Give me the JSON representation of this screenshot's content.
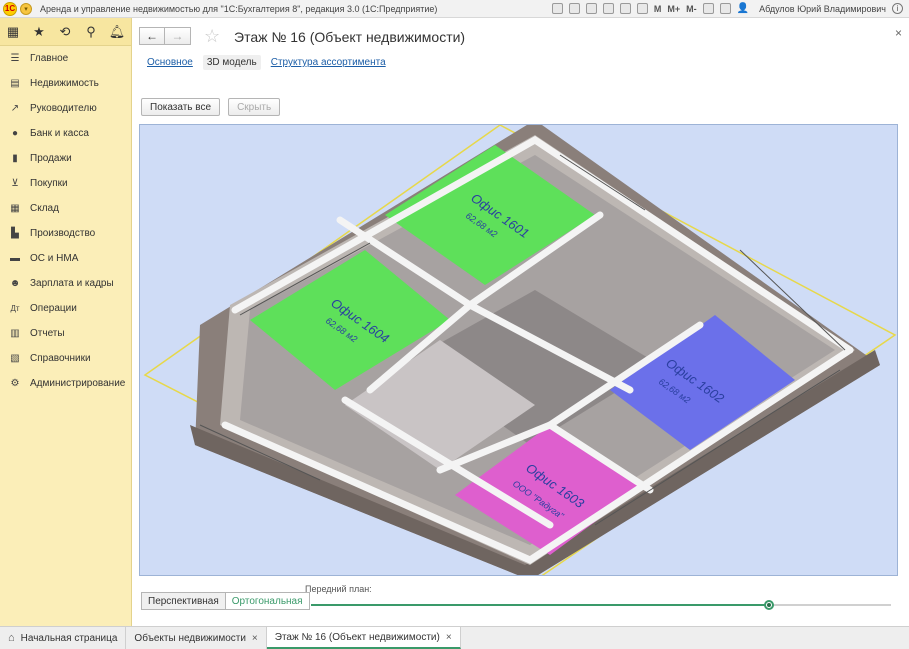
{
  "window": {
    "title": "Аренда и управление недвижимостью для \"1С:Бухгалтерия 8\", редакция 3.0  (1С:Предприятие)",
    "toolbar_text": [
      "M",
      "M+",
      "M-"
    ],
    "user": "Абдулов Юрий Владимирович"
  },
  "sidebar": {
    "items": [
      {
        "label": "Главное",
        "icon": "menu-lines-icon"
      },
      {
        "label": "Недвижимость",
        "icon": "building-icon"
      },
      {
        "label": "Руководителю",
        "icon": "trend-icon"
      },
      {
        "label": "Банк и касса",
        "icon": "coin-icon"
      },
      {
        "label": "Продажи",
        "icon": "bag-icon"
      },
      {
        "label": "Покупки",
        "icon": "cart-icon"
      },
      {
        "label": "Склад",
        "icon": "warehouse-icon"
      },
      {
        "label": "Производство",
        "icon": "factory-icon"
      },
      {
        "label": "ОС и НМА",
        "icon": "truck-icon"
      },
      {
        "label": "Зарплата и кадры",
        "icon": "people-icon"
      },
      {
        "label": "Операции",
        "icon": "operations-icon"
      },
      {
        "label": "Отчеты",
        "icon": "chart-icon"
      },
      {
        "label": "Справочники",
        "icon": "book-icon"
      },
      {
        "label": "Администрирование",
        "icon": "gear-icon"
      }
    ]
  },
  "page": {
    "title": "Этаж № 16 (Объект недвижимости)",
    "tabs": [
      {
        "label": "Основное",
        "active": false
      },
      {
        "label": "3D модель",
        "active": true
      },
      {
        "label": "Структура ассортимента",
        "active": false
      }
    ],
    "show_all": "Показать все",
    "hide": "Скрыть"
  },
  "model": {
    "rooms": [
      {
        "name": "Офис 1601",
        "area": "62,68 м2",
        "color": "#5ee05a"
      },
      {
        "name": "Офис 1604",
        "area": "62,68 м2",
        "color": "#5ee05a"
      },
      {
        "name": "Офис 1602",
        "area": "62,68 м2",
        "color": "#6b70ea"
      },
      {
        "name": "Офис 1603",
        "area": "ООО \"Радуга\"",
        "color": "#de5fce"
      }
    ]
  },
  "view": {
    "perspective": "Перспективная",
    "orthogonal": "Ортогональная",
    "foreground_label": "Передний план:",
    "foreground_value": 0.79
  },
  "bottom_tabs": [
    {
      "label": "Начальная страница",
      "active": false
    },
    {
      "label": "Объекты недвижимости",
      "active": false
    },
    {
      "label": "Этаж № 16 (Объект недвижимости)",
      "active": true
    }
  ]
}
